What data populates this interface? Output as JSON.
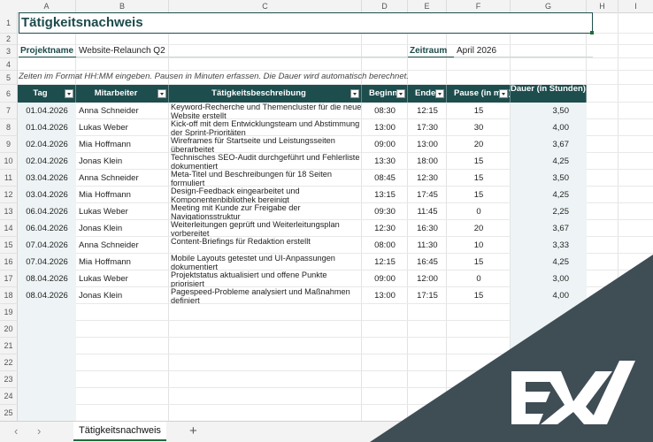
{
  "columns": [
    "A",
    "B",
    "C",
    "D",
    "E",
    "F",
    "G",
    "H",
    "I"
  ],
  "row_numbers": [
    "1",
    "2",
    "3",
    "4",
    "5",
    "6",
    "7",
    "8",
    "9",
    "10",
    "11",
    "12",
    "13",
    "14",
    "15",
    "16",
    "17",
    "18",
    "19",
    "20",
    "21",
    "22",
    "23",
    "24",
    "25"
  ],
  "sheet": {
    "title": "Tätigkeitsnachweis",
    "project_label": "Projektname",
    "project_value": "Website-Relaunch Q2",
    "period_label": "Zeitraum",
    "period_value": "April 2026",
    "note": "Zeiten im Format HH:MM eingeben. Pausen in Minuten erfassen. Die Dauer wird automatisch berechnet."
  },
  "table": {
    "headers": [
      "Tag",
      "Mitarbeiter",
      "Tätigkeitsbeschreibung",
      "Beginn",
      "Ende",
      "Pause (in min)",
      "Dauer (in Stunden)"
    ],
    "rows": [
      [
        "01.04.2026",
        "Anna Schneider",
        "Keyword-Recherche und Themencluster für die neue Website erstellt",
        "08:30",
        "12:15",
        "15",
        "3,50"
      ],
      [
        "01.04.2026",
        "Lukas Weber",
        "Kick-off mit dem Entwicklungsteam und Abstimmung der Sprint-Prioritäten",
        "13:00",
        "17:30",
        "30",
        "4,00"
      ],
      [
        "02.04.2026",
        "Mia Hoffmann",
        "Wireframes für Startseite und Leistungsseiten überarbeitet",
        "09:00",
        "13:00",
        "20",
        "3,67"
      ],
      [
        "02.04.2026",
        "Jonas Klein",
        "Technisches SEO-Audit durchgeführt und Fehlerliste dokumentiert",
        "13:30",
        "18:00",
        "15",
        "4,25"
      ],
      [
        "03.04.2026",
        "Anna Schneider",
        "Meta-Titel und Beschreibungen für 18 Seiten formuliert",
        "08:45",
        "12:30",
        "15",
        "3,50"
      ],
      [
        "03.04.2026",
        "Mia Hoffmann",
        "Design-Feedback eingearbeitet und Komponentenbibliothek bereinigt",
        "13:15",
        "17:45",
        "15",
        "4,25"
      ],
      [
        "06.04.2026",
        "Lukas Weber",
        "Meeting mit Kunde zur Freigabe der Navigationsstruktur",
        "09:30",
        "11:45",
        "0",
        "2,25"
      ],
      [
        "06.04.2026",
        "Jonas Klein",
        "Weiterleitungen geprüft und Weiterleitungsplan vorbereitet",
        "12:30",
        "16:30",
        "20",
        "3,67"
      ],
      [
        "07.04.2026",
        "Anna Schneider",
        "Content-Briefings für Redaktion erstellt",
        "08:00",
        "11:30",
        "10",
        "3,33"
      ],
      [
        "07.04.2026",
        "Mia Hoffmann",
        "Mobile Layouts getestet und UI-Anpassungen dokumentiert",
        "12:15",
        "16:45",
        "15",
        "4,25"
      ],
      [
        "08.04.2026",
        "Lukas Weber",
        "Projektstatus aktualisiert und offene Punkte priorisiert",
        "09:00",
        "12:00",
        "0",
        "3,00"
      ],
      [
        "08.04.2026",
        "Jonas Klein",
        "Pagespeed-Probleme analysiert und Maßnahmen definiert",
        "13:00",
        "17:15",
        "15",
        "4,00"
      ]
    ]
  },
  "tabs": {
    "active": "Tätigkeitsnachweis",
    "add": "+",
    "prev": "‹",
    "next": "›"
  },
  "colors": {
    "header_bg": "#1e4d4e",
    "title_text": "#1c4a4a",
    "logo_bg": "#3f4d55"
  },
  "icons": {
    "filter": "filter-dropdown-icon",
    "add": "plus-icon",
    "logo": "brand-logo-icon"
  }
}
